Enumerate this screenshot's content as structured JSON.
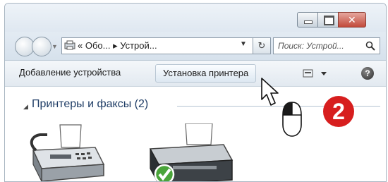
{
  "window": {
    "caption_buttons": [
      "minimize",
      "maximize",
      "close"
    ]
  },
  "navigation": {
    "address_path": "« Обо... ▸ Устрой...",
    "address_icon": "devices-folder-icon",
    "search_placeholder": "Поиск: Устрой...",
    "search_icon": "magnifier-icon"
  },
  "toolbar": {
    "add_device_label": "Добавление устройства",
    "install_printer_label": "Установка принтера",
    "view_icon": "view-options-icon",
    "help_label": "?"
  },
  "content": {
    "group_title": "Принтеры и факсы (2)",
    "devices": [
      {
        "icon": "fax-icon"
      },
      {
        "icon": "printer-default-icon"
      }
    ]
  },
  "annotation": {
    "step_number": "2",
    "badge_color": "#d71e1e"
  }
}
